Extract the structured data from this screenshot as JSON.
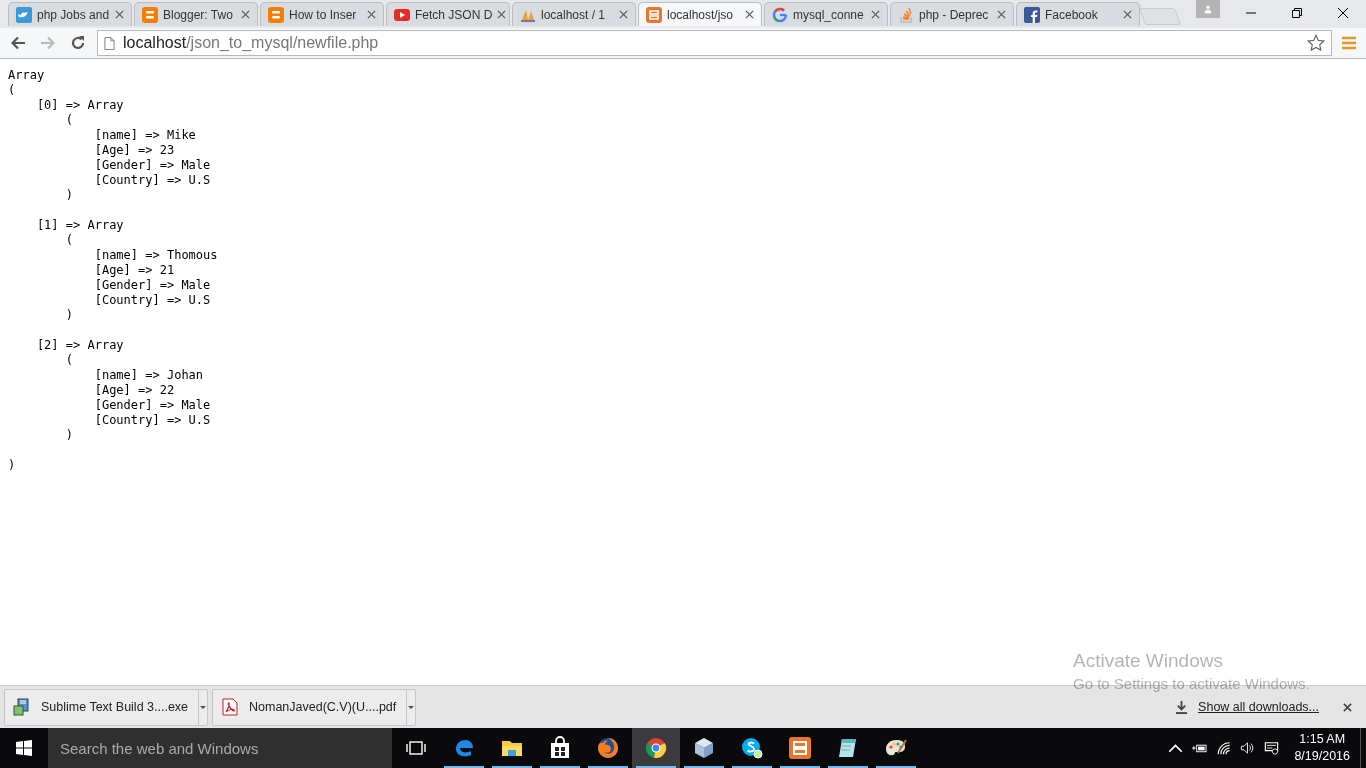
{
  "tabs": [
    {
      "kind": "bird",
      "title": "php Jobs and",
      "selected": false
    },
    {
      "kind": "blogger",
      "title": "Blogger: Two",
      "selected": false
    },
    {
      "kind": "blogger",
      "title": "How to Inser",
      "selected": false
    },
    {
      "kind": "video",
      "title": "Fetch JSON D",
      "selected": false
    },
    {
      "kind": "pma",
      "title": "localhost / 1",
      "selected": false
    },
    {
      "kind": "xampp",
      "title": "localhost/jso",
      "selected": true
    },
    {
      "kind": "google",
      "title": "mysql_conne",
      "selected": false
    },
    {
      "kind": "stack",
      "title": "php - Deprec",
      "selected": false
    },
    {
      "kind": "facebook",
      "title": "Facebook",
      "selected": false
    }
  ],
  "toolbar": {
    "back_disabled": false,
    "forward_disabled": true,
    "address": {
      "host": "localhost",
      "path": "/json_to_mysql/newfile.php"
    },
    "bookmarked": false
  },
  "page": {
    "lines": [
      {
        "text": "Array"
      },
      {
        "text": "(",
        "children": [
          {
            "text": "[0] => Array",
            "children": [
              {
                "text": "(",
                "children": [
                  {
                    "text": "[name] => Mike"
                  },
                  {
                    "text": "[Age] => 23"
                  },
                  {
                    "text": "[Gender] => Male"
                  },
                  {
                    "text": "[Country] => U.S"
                  }
                ]
              },
              {
                "text": ")"
              }
            ]
          },
          {
            "text": "[1] => Array",
            "children": [
              {
                "text": "(",
                "children": [
                  {
                    "text": "[name] => Thomous"
                  },
                  {
                    "text": "[Age] => 21"
                  },
                  {
                    "text": "[Gender] => Male"
                  },
                  {
                    "text": "[Country] => U.S"
                  }
                ]
              },
              {
                "text": ")"
              }
            ]
          },
          {
            "text": "[2] => Array",
            "children": [
              {
                "text": "(",
                "children": [
                  {
                    "text": "[name] => Johan"
                  },
                  {
                    "text": "[Age] => 22"
                  },
                  {
                    "text": "[Gender] => Male"
                  },
                  {
                    "text": "[Country] => U.S"
                  }
                ]
              },
              {
                "text": ")"
              }
            ]
          }
        ]
      },
      {
        "text": ")"
      }
    ]
  },
  "activation_notice": {
    "title": "Activate Windows",
    "text": "Go to Settings to activate Windows."
  },
  "downloads": {
    "items": [
      {
        "kind": "installer",
        "name": "Sublime Text Build 3....exe"
      },
      {
        "kind": "pdf",
        "name": "NomanJaved(C.V)(U....pdf"
      }
    ],
    "show_all": "Show all downloads..."
  },
  "taskbar": {
    "search_placeholder": "Search the web and Windows",
    "apps": [
      {
        "kind": "edge",
        "running": true,
        "selected": false
      },
      {
        "kind": "explorer",
        "running": true,
        "selected": false
      },
      {
        "kind": "store",
        "running": true,
        "selected": false
      },
      {
        "kind": "firefox",
        "running": true,
        "selected": false
      },
      {
        "kind": "chrome",
        "running": true,
        "selected": true
      },
      {
        "kind": "cube",
        "running": true,
        "selected": false
      },
      {
        "kind": "skype",
        "running": true,
        "selected": false
      },
      {
        "kind": "xampp",
        "running": true,
        "selected": false
      },
      {
        "kind": "notepad",
        "running": true,
        "selected": false
      },
      {
        "kind": "paint",
        "running": true,
        "selected": false
      }
    ],
    "time": "1:15 AM",
    "date": "8/19/2016"
  }
}
